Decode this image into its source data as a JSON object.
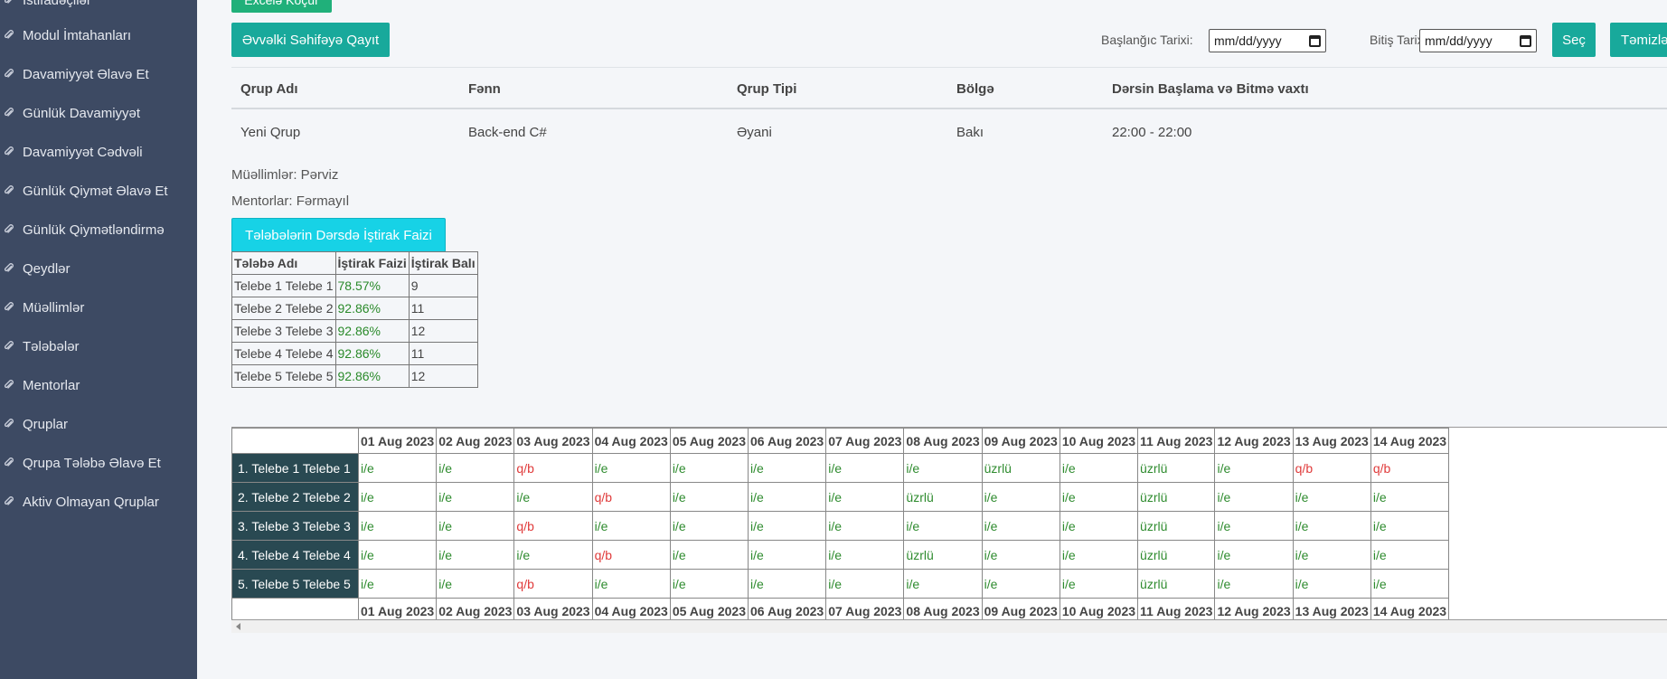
{
  "sidebar": {
    "items": [
      {
        "label": "İstifadəçilər"
      },
      {
        "label": "Modul İmtahanları"
      },
      {
        "label": "Davamiyyət Əlavə Et"
      },
      {
        "label": "Günlük Davamiyyət"
      },
      {
        "label": "Davamiyyət Cədvəli"
      },
      {
        "label": "Günlük Qiymət Əlavə Et"
      },
      {
        "label": "Günlük Qiymətləndirmə"
      },
      {
        "label": "Qeydlər"
      },
      {
        "label": "Müəllimlər"
      },
      {
        "label": "Tələbələr"
      },
      {
        "label": "Mentorlar"
      },
      {
        "label": "Qruplar"
      },
      {
        "label": "Qrupa Tələbə Əlavə Et"
      },
      {
        "label": "Aktiv Olmayan Qruplar"
      }
    ]
  },
  "toolbar": {
    "excel_label": "Excelə Köçür",
    "back_label": "Əvvəlki Səhifəyə Qayıt",
    "start_date_label": "Başlanğıc Tarixi:",
    "start_date_placeholder": "mm/dd/yyyy",
    "end_date_label": "Bitiş Tarixi:",
    "end_date_placeholder": "mm/dd/yyyy",
    "select_label": "Seç",
    "clear_label": "Təmizlə"
  },
  "group_info": {
    "headers": [
      "Qrup Adı",
      "Fənn",
      "Qrup Tipi",
      "Bölgə",
      "Dərsin Başlama və Bitmə vaxtı"
    ],
    "row": [
      "Yeni Qrup",
      "Back-end C#",
      "Əyani",
      "Bakı",
      "22:00 - 22:00"
    ]
  },
  "teachers_line": "Müəllimlər: Pərviz",
  "mentors_line": "Mentorlar: Fərmayıl",
  "participation_button": "Tələbələrin Dərsdə İştirak Faizi",
  "participation": {
    "headers": [
      "Tələbə Adı",
      "İştirak Faizi",
      "İştirak Balı"
    ],
    "rows": [
      [
        "Telebe 1 Telebe 1",
        "78.57%",
        "9"
      ],
      [
        "Telebe 2 Telebe 2",
        "92.86%",
        "11"
      ],
      [
        "Telebe 3 Telebe 3",
        "92.86%",
        "12"
      ],
      [
        "Telebe 4 Telebe 4",
        "92.86%",
        "11"
      ],
      [
        "Telebe 5 Telebe 5",
        "92.86%",
        "12"
      ]
    ]
  },
  "attendance": {
    "dates": [
      "01 Aug 2023",
      "02 Aug 2023",
      "03 Aug 2023",
      "04 Aug 2023",
      "05 Aug 2023",
      "06 Aug 2023",
      "07 Aug 2023",
      "08 Aug 2023",
      "09 Aug 2023",
      "10 Aug 2023",
      "11 Aug 2023",
      "12 Aug 2023",
      "13 Aug 2023",
      "14 Aug 2023"
    ],
    "students": [
      {
        "name": "1. Telebe 1 Telebe 1",
        "marks": [
          "i/e",
          "i/e",
          "q/b",
          "i/e",
          "i/e",
          "i/e",
          "i/e",
          "i/e",
          "üzrlü",
          "i/e",
          "üzrlü",
          "i/e",
          "q/b",
          "q/b"
        ]
      },
      {
        "name": "2. Telebe 2 Telebe 2",
        "marks": [
          "i/e",
          "i/e",
          "i/e",
          "q/b",
          "i/e",
          "i/e",
          "i/e",
          "üzrlü",
          "i/e",
          "i/e",
          "üzrlü",
          "i/e",
          "i/e",
          "i/e"
        ]
      },
      {
        "name": "3. Telebe 3 Telebe 3",
        "marks": [
          "i/e",
          "i/e",
          "q/b",
          "i/e",
          "i/e",
          "i/e",
          "i/e",
          "i/e",
          "i/e",
          "i/e",
          "üzrlü",
          "i/e",
          "i/e",
          "i/e"
        ]
      },
      {
        "name": "4. Telebe 4 Telebe 4",
        "marks": [
          "i/e",
          "i/e",
          "i/e",
          "q/b",
          "i/e",
          "i/e",
          "i/e",
          "üzrlü",
          "i/e",
          "i/e",
          "üzrlü",
          "i/e",
          "i/e",
          "i/e"
        ]
      },
      {
        "name": "5. Telebe 5 Telebe 5",
        "marks": [
          "i/e",
          "i/e",
          "q/b",
          "i/e",
          "i/e",
          "i/e",
          "i/e",
          "i/e",
          "i/e",
          "i/e",
          "üzrlü",
          "i/e",
          "i/e",
          "i/e"
        ]
      }
    ]
  },
  "colors": {
    "sidebar_bg": "#3d4a63",
    "present": "#2e8b2e",
    "absent": "#e03b3b",
    "row_header_bg": "#294952",
    "primary_button": "#18a99b",
    "excel_button": "#20b07a",
    "cyan_button": "#17d2e6"
  },
  "icons": {
    "sidebar_item_icon": "paperclip-icon",
    "date_picker_icon": "calendar-icon"
  }
}
